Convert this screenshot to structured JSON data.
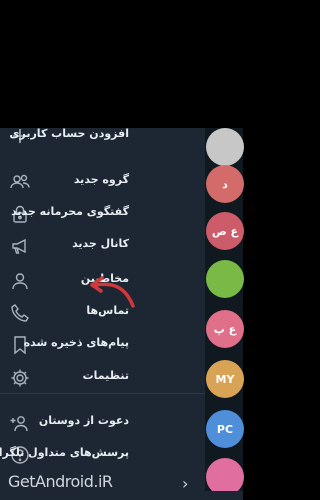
{
  "menu": [
    {
      "label": "افزودن حساب کاربری",
      "icon": "plus-icon"
    },
    {
      "label": "گروه جدید",
      "icon": "people-icon"
    },
    {
      "label": "گفتگوی محرمانه جدید",
      "icon": "lock-icon"
    },
    {
      "label": "کانال جدید",
      "icon": "megaphone-icon"
    },
    {
      "label": "مخاطبین",
      "icon": "person-icon"
    },
    {
      "label": "تماس‌ها",
      "icon": "phone-icon"
    },
    {
      "label": "پیام‌های ذخیره شده",
      "icon": "bookmark-icon"
    },
    {
      "label": "تنظیمات",
      "icon": "gear-icon"
    },
    {
      "label": "دعوت از دوستان",
      "icon": "add-person-icon"
    },
    {
      "label": "پرسش‌های متداول تلگرام",
      "icon": "help-icon"
    }
  ],
  "avatars": [
    {
      "text": "",
      "color": "#c7c7c7"
    },
    {
      "text": "د",
      "color": "#d46b6b"
    },
    {
      "text": "ع ص",
      "color": "#cc5c6a"
    },
    {
      "text": "",
      "color": "#79b945"
    },
    {
      "text": "ع پ",
      "color": "#e0708a"
    },
    {
      "text": "MY",
      "color": "#d9a355"
    },
    {
      "text": "PC",
      "color": "#4f8fd9"
    },
    {
      "text": "",
      "color": "#e06fa0"
    }
  ],
  "watermark": "GetAndroid.iR",
  "accent": "#d2383a"
}
